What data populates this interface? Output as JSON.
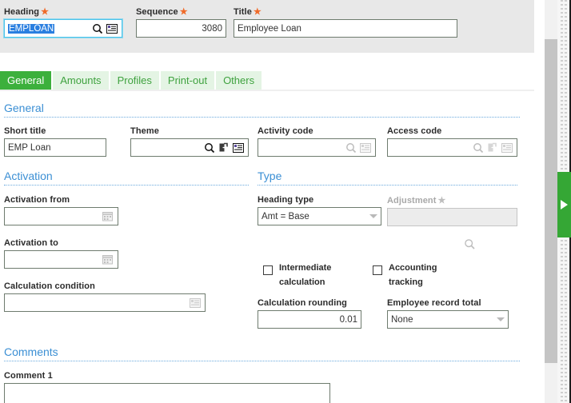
{
  "header": {
    "heading": {
      "label": "Heading",
      "required_star": "★",
      "value": "EMPLOAN",
      "icons": [
        "search-icon",
        "list-icon"
      ]
    },
    "sequence": {
      "label": "Sequence",
      "required_star": "★",
      "value": "3080"
    },
    "title": {
      "label": "Title",
      "required_star": "★",
      "value": "Employee Loan"
    }
  },
  "tabs": [
    {
      "label": "General",
      "active": true
    },
    {
      "label": "Amounts",
      "active": false
    },
    {
      "label": "Profiles",
      "active": false
    },
    {
      "label": "Print-out",
      "active": false
    },
    {
      "label": "Others",
      "active": false
    }
  ],
  "sections": {
    "general": {
      "title": "General",
      "short_title": {
        "label": "Short title",
        "value": "EMP Loan"
      },
      "theme": {
        "label": "Theme",
        "value": "",
        "icons": [
          "search-icon",
          "new-window-icon",
          "list-icon"
        ]
      },
      "activity_code": {
        "label": "Activity code",
        "value": "",
        "disabled": true,
        "icons": [
          "search-icon",
          "list-icon"
        ]
      },
      "access_code": {
        "label": "Access code",
        "value": "",
        "disabled": true,
        "icons": [
          "search-icon",
          "new-window-icon",
          "list-icon"
        ]
      }
    },
    "activation": {
      "title": "Activation",
      "activation_from": {
        "label": "Activation from",
        "value": "",
        "icons": [
          "calendar-icon"
        ]
      },
      "activation_to": {
        "label": "Activation to",
        "value": "",
        "icons": [
          "calendar-icon"
        ]
      },
      "calculation_condition": {
        "label": "Calculation condition",
        "value": "",
        "icons": [
          "list-icon"
        ]
      }
    },
    "type": {
      "title": "Type",
      "heading_type": {
        "label": "Heading type",
        "value": "Amt = Base"
      },
      "adjustment": {
        "label": "Adjustment",
        "required_star": "★",
        "value": "",
        "disabled": true
      },
      "lookup_icon": "search-icon",
      "intermediate_calculation": {
        "label_line1": "Intermediate",
        "label_line2": "calculation",
        "checked": false
      },
      "accounting_tracking": {
        "label_line1": "Accounting",
        "label_line2": "tracking",
        "checked": false
      },
      "calculation_rounding": {
        "label": "Calculation rounding",
        "value": "0.01"
      },
      "employee_record_total": {
        "label": "Employee record total",
        "value": "None"
      }
    },
    "comments": {
      "title": "Comments",
      "comment_1": {
        "label": "Comment 1",
        "value": ""
      }
    }
  },
  "side_panel": {
    "expand_tab": "expand-panel-arrow"
  },
  "colors": {
    "accent_green": "#3cb03c",
    "section_blue": "#3b8fd4",
    "required_orange": "#f06a28",
    "header_band": "#e8e8e8"
  }
}
